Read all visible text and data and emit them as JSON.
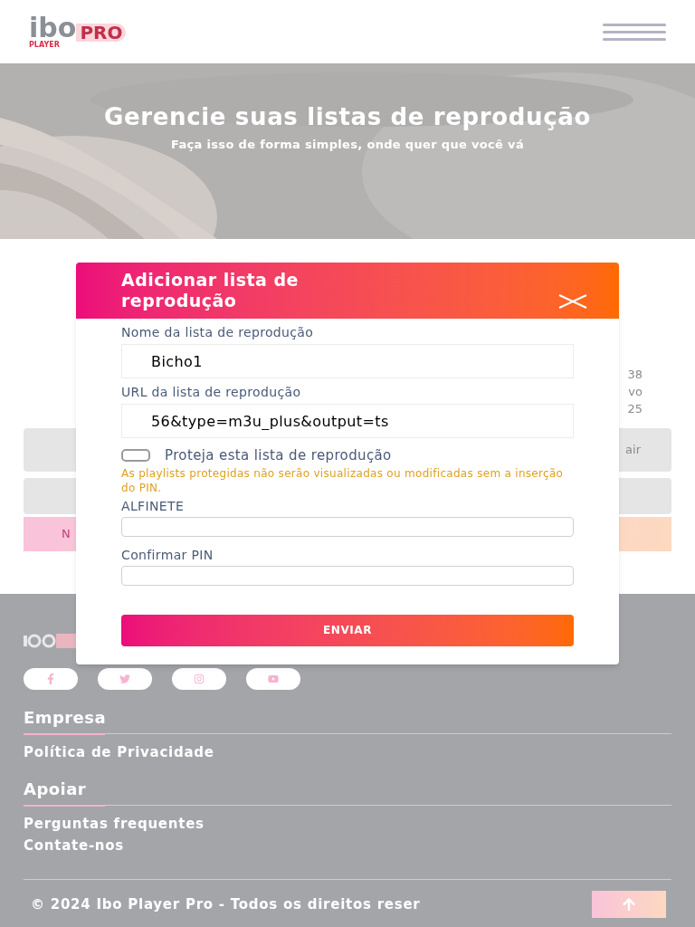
{
  "header": {
    "logo": {
      "main": "ibo",
      "sub": "PLAYER",
      "pro": "PRO"
    }
  },
  "hero": {
    "title": "Gerencie suas listas de reprodução",
    "subtitle": "Faça isso de forma simples, onde quer que você vá"
  },
  "background_fragments": {
    "lines": [
      "38",
      "vo",
      "25"
    ],
    "button_1": "air",
    "button_3": "N"
  },
  "modal": {
    "title": "Adicionar lista de reprodução",
    "fields": [
      {
        "label": "Nome da lista de reprodução",
        "value": "Bicho1"
      },
      {
        "label": "URL da lista de reprodução",
        "value": "56&type=m3u_plus&output=ts"
      }
    ],
    "protect": {
      "label": "Proteja esta lista de reprodução",
      "checked": false,
      "note": "As playlists protegidas não serão visualizadas ou modificadas sem a inserção do PIN."
    },
    "pin_fields": [
      {
        "label": "ALFINETE"
      },
      {
        "label": "Confirmar PIN"
      }
    ],
    "submit": "ENVIAR"
  },
  "footer": {
    "social": [
      {
        "kind": "facebook"
      },
      {
        "kind": "twitter"
      },
      {
        "kind": "instagram"
      },
      {
        "kind": "youtube"
      }
    ],
    "sections": [
      {
        "title": "Empresa",
        "links": [
          "Política de Privacidade"
        ]
      },
      {
        "title": "Apoiar",
        "links": [
          "Perguntas frequentes",
          "Contate-nos"
        ]
      }
    ],
    "copyright": "© 2024 Ibo Player Pro - Todos os direitos reser"
  }
}
